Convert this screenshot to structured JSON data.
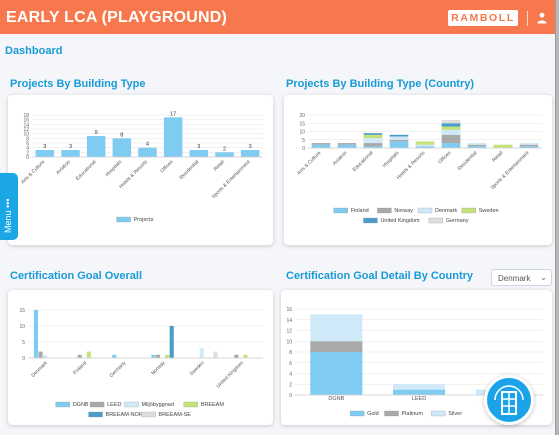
{
  "header": {
    "title": "EARLY LCA (PLAYGROUND)",
    "brand": "RAMBOLL"
  },
  "dashboard_title": "Dashboard",
  "menu_label": "Menu •••",
  "sections": {
    "projects_by_type": "Projects By Building Type",
    "projects_by_type_country": "Projects By Building Type (Country)",
    "cert_overall": "Certification Goal Overall",
    "cert_detail": "Certification Goal Detail By Country"
  },
  "country_select": {
    "selected": "Denmark"
  },
  "chart_data": [
    {
      "type": "bar",
      "title": "Projects By Building Type",
      "categories": [
        "Arts & Culture",
        "Aviation",
        "Educational",
        "Hospitals",
        "Hotels & Resorts",
        "Offices",
        "Residential",
        "Retail",
        "Sports & Entertainment"
      ],
      "series": [
        {
          "name": "Projects",
          "values": [
            3,
            3,
            9,
            8,
            4,
            17,
            3,
            2,
            3
          ]
        }
      ],
      "ylim": [
        0,
        18
      ],
      "yticks": [
        0,
        2,
        4,
        6,
        8,
        10,
        12,
        14,
        16,
        18
      ],
      "colors": {
        "Projects": "#7fcbf1"
      },
      "legend": "bottom",
      "grid": true
    },
    {
      "type": "bar",
      "title": "Projects By Building Type (Country)",
      "stacked": true,
      "categories": [
        "Arts & Culture",
        "Aviation",
        "Educational",
        "Hospitals",
        "Hotels & Resorts",
        "Offices",
        "Residential",
        "Retail",
        "Sports & Entertainment"
      ],
      "series": [
        {
          "name": "Finland",
          "values": [
            2,
            2,
            1,
            4,
            1,
            3,
            1,
            0,
            1
          ]
        },
        {
          "name": "Norway",
          "values": [
            1,
            1,
            2,
            1,
            0,
            5,
            1,
            0,
            1
          ]
        },
        {
          "name": "Denmark",
          "values": [
            0,
            0,
            3,
            2,
            1,
            3,
            1,
            0,
            1
          ]
        },
        {
          "name": "Sweden",
          "values": [
            0,
            0,
            2,
            0,
            2,
            2,
            0,
            2,
            0
          ]
        },
        {
          "name": "United Kingdom",
          "values": [
            0,
            0,
            1,
            1,
            0,
            2,
            0,
            0,
            0
          ]
        },
        {
          "name": "Germany",
          "values": [
            0,
            0,
            0,
            0,
            0,
            2,
            0,
            0,
            0
          ]
        }
      ],
      "ylim": [
        0,
        20
      ],
      "yticks": [
        0,
        5,
        10,
        15,
        20
      ],
      "colors": {
        "Finland": "#7fcbf1",
        "Norway": "#a9a9a9",
        "Denmark": "#cfe9f8",
        "Sweden": "#c3e27a",
        "United Kingdom": "#4a9cc9",
        "Germany": "#dedede"
      },
      "legend": "bottom",
      "grid": true
    },
    {
      "type": "bar",
      "title": "Certification Goal Overall",
      "categories": [
        "Denmark",
        "Finland",
        "Germany",
        "Norway",
        "Sweden",
        "United Kingdom"
      ],
      "series": [
        {
          "name": "DGNB",
          "values": [
            15,
            0,
            1,
            1,
            0,
            0
          ]
        },
        {
          "name": "LEED",
          "values": [
            2,
            1,
            0,
            1,
            0,
            1
          ]
        },
        {
          "name": "Miljöbyggnad",
          "values": [
            1,
            0,
            0,
            0,
            3,
            0
          ]
        },
        {
          "name": "BREEAM",
          "values": [
            0,
            2,
            0,
            1,
            0,
            1
          ]
        },
        {
          "name": "BREEAM-NOR",
          "values": [
            0,
            0,
            0,
            10,
            0,
            0
          ]
        },
        {
          "name": "BREEAM-SE",
          "values": [
            0,
            0,
            0,
            0,
            2,
            0
          ]
        }
      ],
      "ylim": [
        0,
        15
      ],
      "yticks": [
        0,
        5,
        10,
        15
      ],
      "colors": {
        "DGNB": "#7fcbf1",
        "LEED": "#a9a9a9",
        "Miljöbyggnad": "#cfe9f8",
        "BREEAM": "#c3e27a",
        "BREEAM-NOR": "#4a9cc9",
        "BREEAM-SE": "#dedede"
      },
      "legend": "bottom",
      "grid": true
    },
    {
      "type": "bar",
      "title": "Certification Goal Detail By Country",
      "stacked": true,
      "categories": [
        "DGNB",
        "LEED",
        "Miljöbyggnad"
      ],
      "series": [
        {
          "name": "Gold",
          "values": [
            8,
            1,
            0
          ]
        },
        {
          "name": "Platinum",
          "values": [
            2,
            0,
            0
          ]
        },
        {
          "name": "Silver",
          "values": [
            5,
            1,
            1
          ]
        }
      ],
      "ylim": [
        0,
        16
      ],
      "yticks": [
        0,
        2,
        4,
        6,
        8,
        10,
        12,
        14,
        16
      ],
      "colors": {
        "Gold": "#7fcbf1",
        "Platinum": "#a9a9a9",
        "Silver": "#cfe9f8"
      },
      "legend": "bottom",
      "grid": true
    }
  ]
}
